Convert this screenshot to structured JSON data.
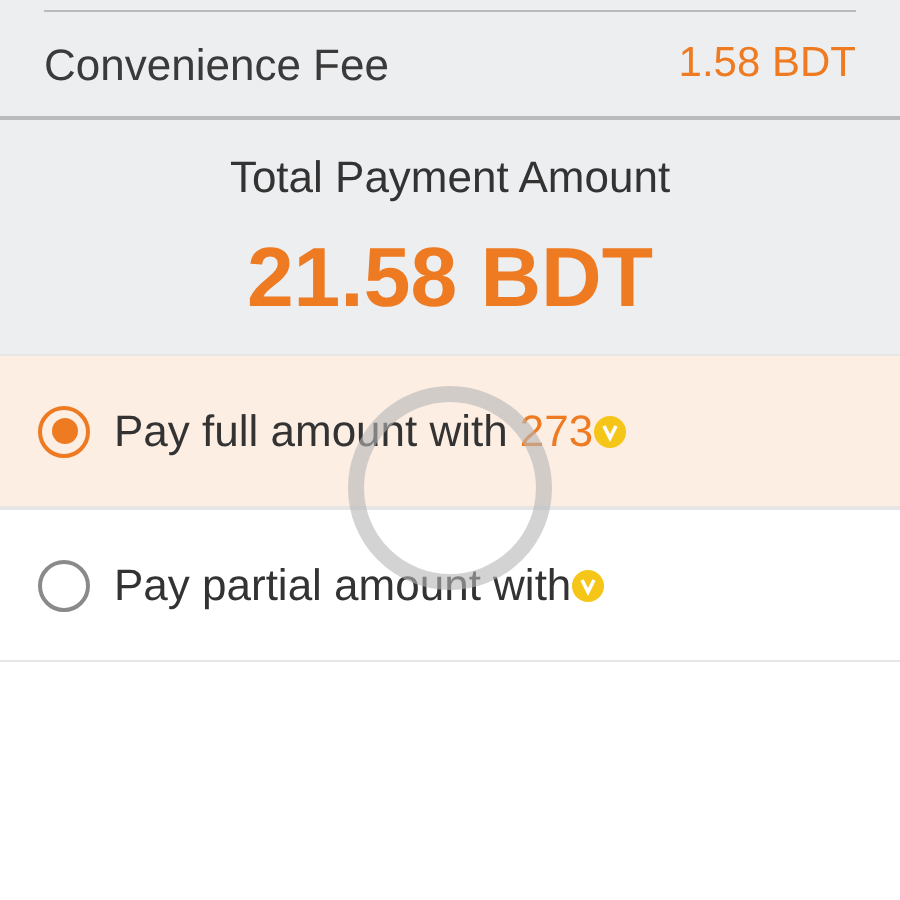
{
  "fee": {
    "label": "Convenience Fee",
    "value": "1.58 BDT"
  },
  "total": {
    "label": "Total Payment Amount",
    "value": "21.58 BDT"
  },
  "options": [
    {
      "label": "Pay full amount with",
      "amount": "273",
      "selected": true
    },
    {
      "label": "Pay partial amount with",
      "selected": false
    }
  ],
  "loading": true
}
